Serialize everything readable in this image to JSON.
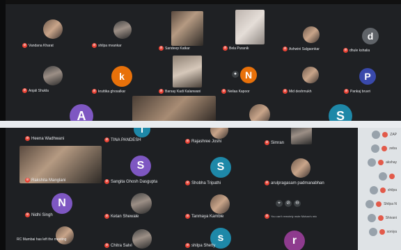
{
  "top_panel": {
    "participants": [
      {
        "id": "t1",
        "name": "Vandana Kharat",
        "initial": "",
        "color": "",
        "kind": "photo"
      },
      {
        "id": "t2",
        "name": "shilpa mvankar",
        "initial": "",
        "color": "",
        "kind": "photo"
      },
      {
        "id": "t3",
        "name": "Sandeep Katkar",
        "initial": "",
        "color": "",
        "kind": "video"
      },
      {
        "id": "t4",
        "name": "Bela Puranik",
        "initial": "",
        "color": "",
        "kind": "video"
      },
      {
        "id": "t5",
        "name": "Ashwini Salgaonkar",
        "initial": "",
        "color": "",
        "kind": "photo"
      },
      {
        "id": "t6",
        "name": "dhule kshalia",
        "initial": "d",
        "color": "#5f6368",
        "kind": "initial"
      },
      {
        "id": "t7",
        "name": "Anjali Shukla",
        "initial": "",
        "color": "",
        "kind": "photo"
      },
      {
        "id": "t8",
        "name": "kruttika ghosalkar",
        "initial": "k",
        "color": "#e8710a",
        "kind": "initial"
      },
      {
        "id": "t9",
        "name": "Barsay Kadi Kalanwani",
        "initial": "",
        "color": "",
        "kind": "video"
      },
      {
        "id": "t10",
        "name": "Neilaa Kapoor",
        "initial": "N",
        "color": "#e8710a",
        "kind": "initial"
      },
      {
        "id": "t11",
        "name": "Mid deshmukh",
        "initial": "",
        "color": "",
        "kind": "photo"
      },
      {
        "id": "t12",
        "name": "Pankaj bruvri",
        "initial": "P",
        "color": "#3949ab",
        "kind": "initial"
      },
      {
        "id": "t13",
        "name": "",
        "initial": "A",
        "color": "#7e57c2",
        "kind": "initial"
      },
      {
        "id": "t14",
        "name": "",
        "initial": "",
        "color": "",
        "kind": "video"
      },
      {
        "id": "t15",
        "name": "",
        "initial": "",
        "color": "",
        "kind": "photo"
      },
      {
        "id": "t16",
        "name": "",
        "initial": "S",
        "color": "#1e88a8",
        "kind": "initial"
      }
    ]
  },
  "bottom_panel": {
    "participants": [
      {
        "id": "b1",
        "name": "Heena Wadhwani",
        "initial": "",
        "kind": "photo",
        "color": ""
      },
      {
        "id": "b2",
        "name": "TINA PANDESH",
        "initial": "T",
        "kind": "initial",
        "color": "#1e88a8"
      },
      {
        "id": "b3",
        "name": "Rajashree Joshi",
        "initial": "",
        "kind": "photo",
        "color": ""
      },
      {
        "id": "b4",
        "name": "Simran",
        "initial": "",
        "kind": "photo",
        "color": ""
      },
      {
        "id": "b5",
        "name": "Rakshita Manglani",
        "initial": "",
        "kind": "video",
        "color": ""
      },
      {
        "id": "b6",
        "name": "Sangita Ghosh Dasgupta",
        "initial": "S",
        "kind": "initial",
        "color": "#7e57c2"
      },
      {
        "id": "b7",
        "name": "Shobha Tripathi",
        "initial": "S",
        "kind": "initial",
        "color": "#1e88a8"
      },
      {
        "id": "b8",
        "name": "arulpragasam padmanabhan",
        "initial": "",
        "kind": "photo",
        "color": ""
      },
      {
        "id": "b9",
        "name": "Nidhi Singh",
        "initial": "N",
        "kind": "initial",
        "color": "#7e57c2"
      },
      {
        "id": "b10",
        "name": "Ketan Shewale",
        "initial": "",
        "kind": "photo",
        "color": ""
      },
      {
        "id": "b11",
        "name": "Tanmaya Kamble",
        "initial": "",
        "kind": "photo",
        "color": ""
      },
      {
        "id": "b12",
        "name": "",
        "initial": "",
        "kind": "photo",
        "color": ""
      },
      {
        "id": "b13",
        "name": "Chitra Salvi",
        "initial": "",
        "kind": "photo",
        "color": ""
      },
      {
        "id": "b14",
        "name": "shilpa Shetty",
        "initial": "s",
        "kind": "initial",
        "color": "#1e88a8"
      },
      {
        "id": "b15",
        "name": "",
        "initial": "r",
        "kind": "initial",
        "color": "#8e3b8e"
      }
    ],
    "toast": "RC Mumbai has left the meeting",
    "popup_text": "You can't remotely mute Mohan's mic"
  },
  "sidebar": {
    "items": [
      {
        "label": "ZAP"
      },
      {
        "label": "zeba"
      },
      {
        "label": "akshay"
      },
      {
        "label": ""
      },
      {
        "label": "shilpa"
      },
      {
        "label": "Shilpa N"
      },
      {
        "label": "Shivani"
      },
      {
        "label": "soniya"
      }
    ]
  },
  "colors": {
    "meet_bg": "#202124",
    "mic_off": "#ea4335"
  }
}
